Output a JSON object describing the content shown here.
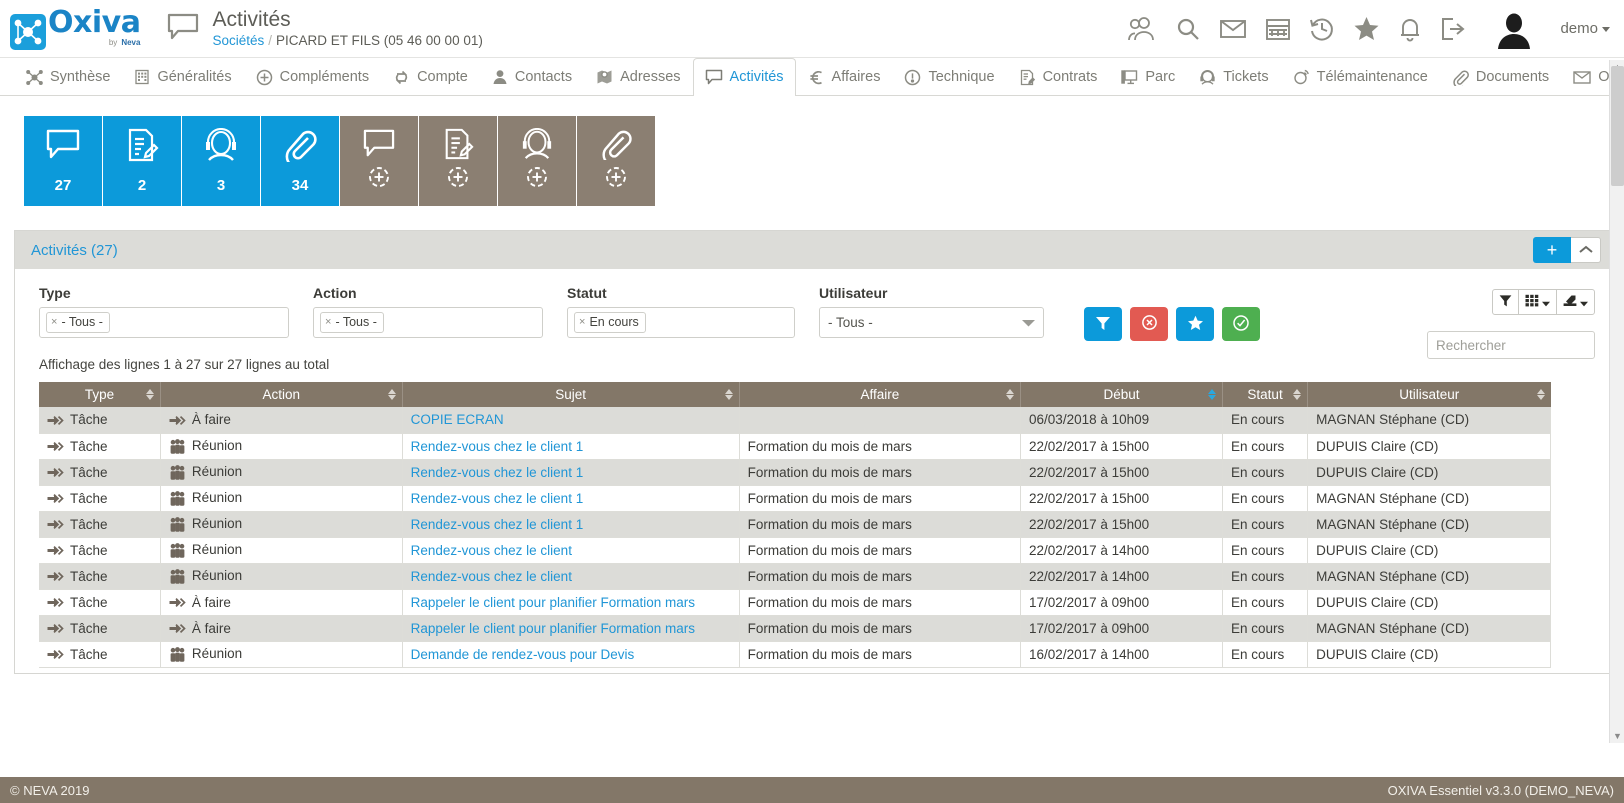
{
  "brand": {
    "name": "Oxiva",
    "byline_prefix": "by",
    "byline_name": "Neva",
    "accent": "#1b84c6",
    "tile_blue": "#0c9ada",
    "tile_brown": "#8b7f72",
    "header_brown": "#837768"
  },
  "header": {
    "page_icon": "speech-bubble-icon",
    "title": "Activités",
    "breadcrumb_root": "Sociétés",
    "breadcrumb_sep": "/",
    "breadcrumb_current": "PICARD ET FILS (05 46 00 00 01)",
    "icons": [
      "users-icon",
      "search-icon",
      "mail-icon",
      "calendar-icon",
      "history-icon",
      "star-icon",
      "bell-icon",
      "logout-icon"
    ],
    "user": "demo",
    "avatar": "avatar"
  },
  "nav": {
    "tabs": [
      {
        "label": "Synthèse",
        "icon": "network-icon",
        "active": false
      },
      {
        "label": "Généralités",
        "icon": "building-icon",
        "active": false
      },
      {
        "label": "Compléments",
        "icon": "plus-circle-icon",
        "active": false
      },
      {
        "label": "Compte",
        "icon": "exchange-icon",
        "active": false
      },
      {
        "label": "Contacts",
        "icon": "person-icon",
        "active": false
      },
      {
        "label": "Adresses",
        "icon": "map-pin-icon",
        "active": false
      },
      {
        "label": "Activités",
        "icon": "speech-bubble-icon",
        "active": true
      },
      {
        "label": "Affaires",
        "icon": "euro-icon",
        "active": false
      },
      {
        "label": "Technique",
        "icon": "warning-circle-icon",
        "active": false
      },
      {
        "label": "Contrats",
        "icon": "contract-icon",
        "active": false
      },
      {
        "label": "Parc",
        "icon": "monitor-icon",
        "active": false
      },
      {
        "label": "Tickets",
        "icon": "headset-icon",
        "active": false
      },
      {
        "label": "Télémaintenance",
        "icon": "remote-support-icon",
        "active": false
      },
      {
        "label": "Documents",
        "icon": "paperclip-icon",
        "active": false
      },
      {
        "label": "Oximail",
        "icon": "mail-icon",
        "active": false
      }
    ]
  },
  "tiles": [
    {
      "icon": "speech-bubble-icon",
      "count": "27",
      "style": "blue",
      "add": false
    },
    {
      "icon": "note-edit-icon",
      "count": "2",
      "style": "blue",
      "add": false
    },
    {
      "icon": "headset-icon",
      "count": "3",
      "style": "blue",
      "add": false
    },
    {
      "icon": "paperclip-icon",
      "count": "34",
      "style": "blue",
      "add": false
    },
    {
      "icon": "speech-bubble-icon",
      "count": "",
      "style": "brown",
      "add": true
    },
    {
      "icon": "note-edit-icon",
      "count": "",
      "style": "brown",
      "add": true
    },
    {
      "icon": "headset-icon",
      "count": "",
      "style": "brown",
      "add": true
    },
    {
      "icon": "paperclip-icon",
      "count": "",
      "style": "brown",
      "add": true
    }
  ],
  "panel": {
    "title": "Activités (27)",
    "add_label": "+",
    "collapse_icon": "chevron-up-icon"
  },
  "filters": {
    "type": {
      "label": "Type",
      "tag": "- Tous -"
    },
    "action": {
      "label": "Action",
      "tag": "- Tous -"
    },
    "statut": {
      "label": "Statut",
      "tag": "En cours"
    },
    "user": {
      "label": "Utilisateur",
      "value": "- Tous -"
    },
    "buttons": [
      {
        "name": "filter-button",
        "icon": "funnel-icon",
        "color": "blue"
      },
      {
        "name": "clear-button",
        "icon": "cancel-icon",
        "color": "red"
      },
      {
        "name": "favorite-button",
        "icon": "star-icon",
        "color": "blue"
      },
      {
        "name": "validate-button",
        "icon": "check-circle-icon",
        "color": "green"
      }
    ]
  },
  "toolbar": {
    "tools": [
      {
        "name": "column-filter-tool",
        "icon": "funnel-icon",
        "caret": false
      },
      {
        "name": "columns-tool",
        "icon": "grid-icon",
        "caret": true
      },
      {
        "name": "export-tool",
        "icon": "export-icon",
        "caret": true
      }
    ]
  },
  "search": {
    "placeholder": "Rechercher",
    "value": ""
  },
  "info_line": "Affichage des lignes 1 à 27 sur 27 lignes au total",
  "table": {
    "columns": [
      {
        "label": "Type",
        "sorted": false
      },
      {
        "label": "Action",
        "sorted": false
      },
      {
        "label": "Sujet",
        "sorted": false
      },
      {
        "label": "Affaire",
        "sorted": false
      },
      {
        "label": "Début",
        "sorted": true
      },
      {
        "label": "Statut",
        "sorted": false
      },
      {
        "label": "Utilisateur",
        "sorted": false
      }
    ],
    "rows": [
      {
        "type": "Tâche",
        "type_icon": "arrow-icon",
        "action": "À faire",
        "action_icon": "arrow-icon",
        "sujet": "COPIE ECRAN",
        "affaire": "",
        "debut": "06/03/2018 à 10h09",
        "statut": "En cours",
        "utilisateur": "MAGNAN Stéphane (CD)"
      },
      {
        "type": "Tâche",
        "type_icon": "arrow-icon",
        "action": "Réunion",
        "action_icon": "people-icon",
        "sujet": "Rendez-vous chez le client 1",
        "affaire": "Formation du mois de mars",
        "debut": "22/02/2017 à 15h00",
        "statut": "En cours",
        "utilisateur": "DUPUIS Claire (CD)"
      },
      {
        "type": "Tâche",
        "type_icon": "arrow-icon",
        "action": "Réunion",
        "action_icon": "people-icon",
        "sujet": "Rendez-vous chez le client 1",
        "affaire": "Formation du mois de mars",
        "debut": "22/02/2017 à 15h00",
        "statut": "En cours",
        "utilisateur": "DUPUIS Claire (CD)"
      },
      {
        "type": "Tâche",
        "type_icon": "arrow-icon",
        "action": "Réunion",
        "action_icon": "people-icon",
        "sujet": "Rendez-vous chez le client 1",
        "affaire": "Formation du mois de mars",
        "debut": "22/02/2017 à 15h00",
        "statut": "En cours",
        "utilisateur": "MAGNAN Stéphane (CD)"
      },
      {
        "type": "Tâche",
        "type_icon": "arrow-icon",
        "action": "Réunion",
        "action_icon": "people-icon",
        "sujet": "Rendez-vous chez le client 1",
        "affaire": "Formation du mois de mars",
        "debut": "22/02/2017 à 15h00",
        "statut": "En cours",
        "utilisateur": "MAGNAN Stéphane (CD)"
      },
      {
        "type": "Tâche",
        "type_icon": "arrow-icon",
        "action": "Réunion",
        "action_icon": "people-icon",
        "sujet": "Rendez-vous chez le client",
        "affaire": "Formation du mois de mars",
        "debut": "22/02/2017 à 14h00",
        "statut": "En cours",
        "utilisateur": "DUPUIS Claire (CD)"
      },
      {
        "type": "Tâche",
        "type_icon": "arrow-icon",
        "action": "Réunion",
        "action_icon": "people-icon",
        "sujet": "Rendez-vous chez le client",
        "affaire": "Formation du mois de mars",
        "debut": "22/02/2017 à 14h00",
        "statut": "En cours",
        "utilisateur": "MAGNAN Stéphane (CD)"
      },
      {
        "type": "Tâche",
        "type_icon": "arrow-icon",
        "action": "À faire",
        "action_icon": "arrow-icon",
        "sujet": "Rappeler le client pour planifier Formation mars",
        "affaire": "Formation du mois de mars",
        "debut": "17/02/2017 à 09h00",
        "statut": "En cours",
        "utilisateur": "DUPUIS Claire (CD)"
      },
      {
        "type": "Tâche",
        "type_icon": "arrow-icon",
        "action": "À faire",
        "action_icon": "arrow-icon",
        "sujet": "Rappeler le client pour planifier Formation mars",
        "affaire": "Formation du mois de mars",
        "debut": "17/02/2017 à 09h00",
        "statut": "En cours",
        "utilisateur": "MAGNAN Stéphane (CD)"
      },
      {
        "type": "Tâche",
        "type_icon": "arrow-icon",
        "action": "Réunion",
        "action_icon": "people-icon",
        "sujet": "Demande de rendez-vous pour Devis",
        "affaire": "Formation du mois de mars",
        "debut": "16/02/2017 à 14h00",
        "statut": "En cours",
        "utilisateur": "DUPUIS Claire (CD)"
      }
    ]
  },
  "footer": {
    "left": "© NEVA 2019",
    "right": "OXIVA Essentiel v3.3.0 (DEMO_NEVA)"
  }
}
